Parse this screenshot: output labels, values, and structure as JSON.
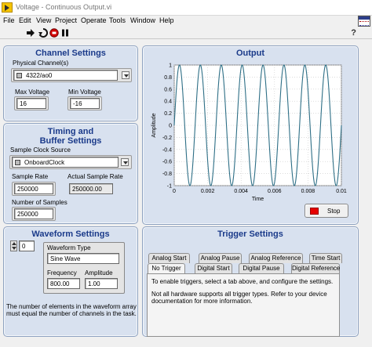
{
  "window": {
    "title": "Voltage - Continuous Output.vi"
  },
  "menu": [
    "File",
    "Edit",
    "View",
    "Project",
    "Operate",
    "Tools",
    "Window",
    "Help"
  ],
  "toolbar": {
    "icons": [
      "run-arrow-icon",
      "run-continuously-icon",
      "abort-icon",
      "pause-icon"
    ],
    "help": "?"
  },
  "channel_settings": {
    "title": "Channel Settings",
    "physical_channel_label": "Physical Channel(s)",
    "physical_channel_value": "4322/ao0",
    "max_voltage_label": "Max Voltage",
    "max_voltage_value": "16",
    "min_voltage_label": "Min Voltage",
    "min_voltage_value": "-16"
  },
  "timing": {
    "title_line1": "Timing and",
    "title_line2": "Buffer Settings",
    "clock_source_label": "Sample Clock Source",
    "clock_source_value": "OnboardClock",
    "sample_rate_label": "Sample Rate",
    "sample_rate_value": "250000",
    "actual_rate_label": "Actual Sample Rate",
    "actual_rate_value": "250000.00",
    "num_samples_label": "Number of Samples",
    "num_samples_value": "250000"
  },
  "waveform": {
    "title": "Waveform Settings",
    "index_value": "0",
    "type_label": "Waveform Type",
    "type_value": "Sine Wave",
    "frequency_label": "Frequency",
    "frequency_value": "800.00",
    "amplitude_label": "Amplitude",
    "amplitude_value": "1.00",
    "note_line1": "The number of elements in the waveform array",
    "note_line2": "must equal the number of channels in the task."
  },
  "output": {
    "title": "Output",
    "stop_label": "Stop"
  },
  "trigger": {
    "title": "Trigger Settings",
    "tabs_back": [
      "Analog Start",
      "Analog Pause",
      "Analog Reference",
      "Time Start"
    ],
    "tabs_front": [
      "No Trigger",
      "Digital Start",
      "Digital Pause",
      "Digital Reference"
    ],
    "active_tab": "No Trigger",
    "text1": "To enable triggers, select a tab above, and configure the settings.",
    "text2_line1": "Not all hardware supports all trigger types. Refer to your device",
    "text2_line2": "documentation for more information."
  },
  "chart_data": {
    "type": "line",
    "title": "",
    "xlabel": "Time",
    "ylabel": "Amplitude",
    "xlim": [
      0,
      0.01
    ],
    "ylim": [
      -1,
      1
    ],
    "x_ticks": [
      "0",
      "0.002",
      "0.004",
      "0.006",
      "0.008",
      "0.01"
    ],
    "y_ticks": [
      "1",
      "0.8",
      "0.6",
      "0.4",
      "0.2",
      "0",
      "-0.2",
      "-0.4",
      "-0.6",
      "-0.8",
      "-1"
    ],
    "grid": true,
    "series": [
      {
        "function": "sine",
        "frequency": 800,
        "amplitude": 1,
        "color": "#2e6f86"
      }
    ],
    "plot_background": "#ffffff"
  }
}
